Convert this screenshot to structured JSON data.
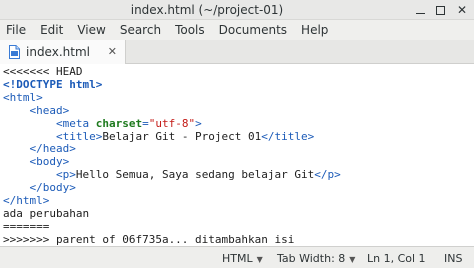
{
  "window": {
    "title": "index.html (~/project-01)",
    "minimize_glyph": "",
    "maximize_glyph": "",
    "close_glyph": "✕"
  },
  "menu": {
    "items": [
      "File",
      "Edit",
      "View",
      "Search",
      "Tools",
      "Documents",
      "Help"
    ]
  },
  "tab": {
    "label": "index.html",
    "close_glyph": "✕"
  },
  "editor": {
    "lines": [
      [
        {
          "t": "<<<<<<< HEAD",
          "c": "plain"
        }
      ],
      [
        {
          "t": "<!DOCTYPE html>",
          "c": "doct"
        }
      ],
      [
        {
          "t": "<html>",
          "c": "tag"
        }
      ],
      [
        {
          "t": "    ",
          "c": "plain"
        },
        {
          "t": "<head>",
          "c": "tag"
        }
      ],
      [
        {
          "t": "        ",
          "c": "plain"
        },
        {
          "t": "<meta ",
          "c": "tag"
        },
        {
          "t": "charset",
          "c": "attr"
        },
        {
          "t": "=",
          "c": "tag"
        },
        {
          "t": "\"utf-8\"",
          "c": "str"
        },
        {
          "t": ">",
          "c": "tag"
        }
      ],
      [
        {
          "t": "        ",
          "c": "plain"
        },
        {
          "t": "<title>",
          "c": "tag"
        },
        {
          "t": "Belajar Git - Project 01",
          "c": "plain"
        },
        {
          "t": "</title>",
          "c": "tag"
        }
      ],
      [
        {
          "t": "    ",
          "c": "plain"
        },
        {
          "t": "</head>",
          "c": "tag"
        }
      ],
      [
        {
          "t": "    ",
          "c": "plain"
        },
        {
          "t": "<body>",
          "c": "tag"
        }
      ],
      [
        {
          "t": "        ",
          "c": "plain"
        },
        {
          "t": "<p>",
          "c": "tag"
        },
        {
          "t": "Hello Semua, Saya sedang belajar Git",
          "c": "plain"
        },
        {
          "t": "</p>",
          "c": "tag"
        }
      ],
      [
        {
          "t": "    ",
          "c": "plain"
        },
        {
          "t": "</body>",
          "c": "tag"
        }
      ],
      [
        {
          "t": "</html>",
          "c": "tag"
        }
      ],
      [
        {
          "t": "ada perubahan",
          "c": "plain"
        }
      ],
      [
        {
          "t": "=======",
          "c": "plain"
        }
      ],
      [
        {
          "t": ">>>>>>> parent of 06f735a... ditambahkan isi",
          "c": "plain"
        }
      ]
    ]
  },
  "status": {
    "language": "HTML",
    "tab_width": "Tab Width: 8",
    "position": "Ln 1, Col 1",
    "mode": "INS"
  }
}
